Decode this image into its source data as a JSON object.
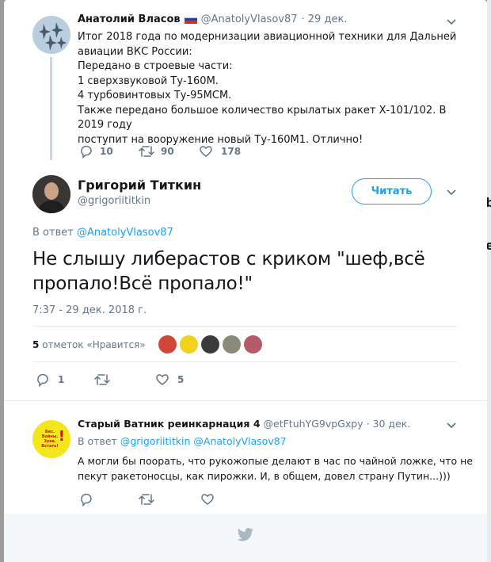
{
  "parent_tweet": {
    "author_name": "Анатолий Власов",
    "flag_icon": "russia-flag-icon",
    "handle": "@AnatolyVlasov87",
    "date": "· 29 дек.",
    "lines": [
      "Итог 2018 года по модернизации авиационной техники для Дальней",
      "авиации ВКС России:",
      "Передано в строевые части:",
      "1 сверхзвуковой Ту-160М.",
      "4 турбовинтовых Ту-95МСМ.",
      "Также передано большое количество крылатых ракет Х-101/102. В 2019 году",
      "поступит на вооружение новый Ту-160М1. Отлично!"
    ],
    "reply_count": "10",
    "retweet_count": "90",
    "like_count": "178"
  },
  "main_tweet": {
    "author_name": "Григорий Титкин",
    "handle": "@grigoriititkin",
    "follow_label": "Читать",
    "reply_prefix": "В ответ",
    "reply_to": "@AnatolyVlasov87",
    "text_lines": [
      "Не слышу либерастов с криком \"шеф,всё",
      "пропало!Всё пропало!\""
    ],
    "timestamp": "7:37 - 29 дек. 2018 г.",
    "likes_count": "5",
    "likes_label": "отметок «Нравится»",
    "reply_count": "1",
    "like_count": "5"
  },
  "reply_tweet": {
    "author_name": "Старый Ватник реинкарнация 4",
    "handle": "@etFtuhYG9vpGxpy",
    "date": "· 30 дек.",
    "avatar_text": "Бес. Войны. Зуев. Встать!",
    "reply_prefix": "В ответ",
    "reply_to_1": "@grigoriititkin",
    "reply_to_2": "@AnatolyVlasov87",
    "lines": [
      "А могли бы поорать, что рукожопые делают в час по чайной ложке, что не",
      "пекут ракетоносцы, как пирожки. И, в общем, довел страну Путин...)))"
    ]
  },
  "colors": {
    "accent": "#1da1f2",
    "muted": "#657786",
    "thread_line": "#ccd6dd",
    "footer_bg": "#f5f8fa"
  }
}
